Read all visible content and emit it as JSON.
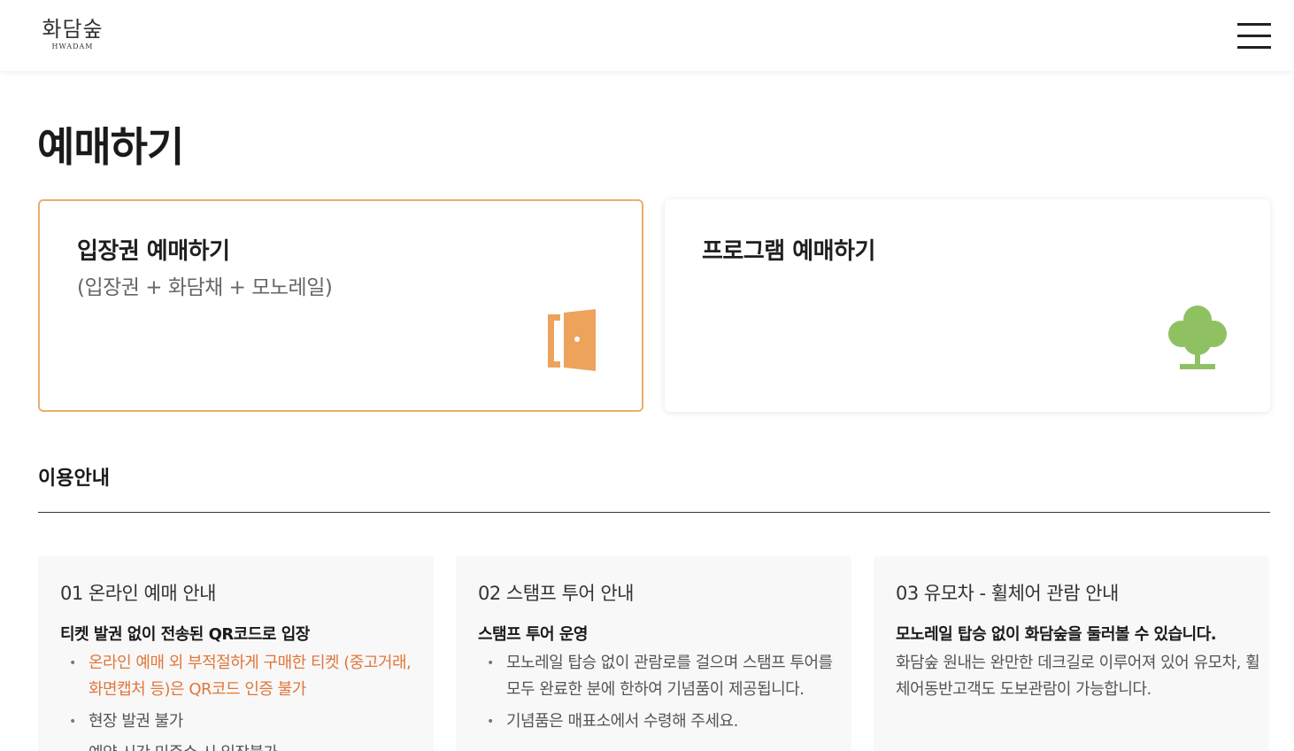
{
  "header": {
    "logo_ko": "화담숲",
    "logo_en": "HWADAM",
    "menu_icon": "hamburger-menu-icon"
  },
  "page": {
    "title": "예매하기"
  },
  "cards": {
    "ticket": {
      "title": "입장권 예매하기",
      "subtitle": "(입장권 + 화담채 + 모노레일)",
      "icon": "door-icon",
      "icon_color": "#eda35c",
      "border_color": "#eaaf6a"
    },
    "program": {
      "title": "프로그램 예매하기",
      "icon": "tree-icon",
      "icon_color": "#8fc163"
    }
  },
  "info": {
    "title": "이용안내",
    "boxes": [
      {
        "heading": "01 온라인 예매 안내",
        "lead": "티켓 발권 없이 전송된 QR코드로 입장",
        "items": [
          "온라인 예매 외 부적절하게 구매한 티켓 (중고거래, 화면캡처 등)은 QR코드 인증 불가",
          "현장 발권 불가",
          "예약 시간 미준수 시 입장불가"
        ],
        "warn_color": "#e0773b"
      },
      {
        "heading": "02 스탬프 투어 안내",
        "lead": "스탬프 투어 운영",
        "items": [
          "모노레일 탑승 없이 관람로를 걸으며 스탬프 투어를 모두 완료한 분에 한하여 기념품이 제공됩니다.",
          "기념품은 매표소에서 수령해 주세요."
        ]
      },
      {
        "heading": "03 유모차 - 휠체어 관람 안내",
        "lead": "모노레일 탑승 없이 화담숲을 둘러볼 수 있습니다.",
        "text": "화담숲 원내는 완만한 데크길로 이루어져 있어 유모차, 휠체어동반고객도 도보관람이 가능합니다."
      }
    ]
  }
}
